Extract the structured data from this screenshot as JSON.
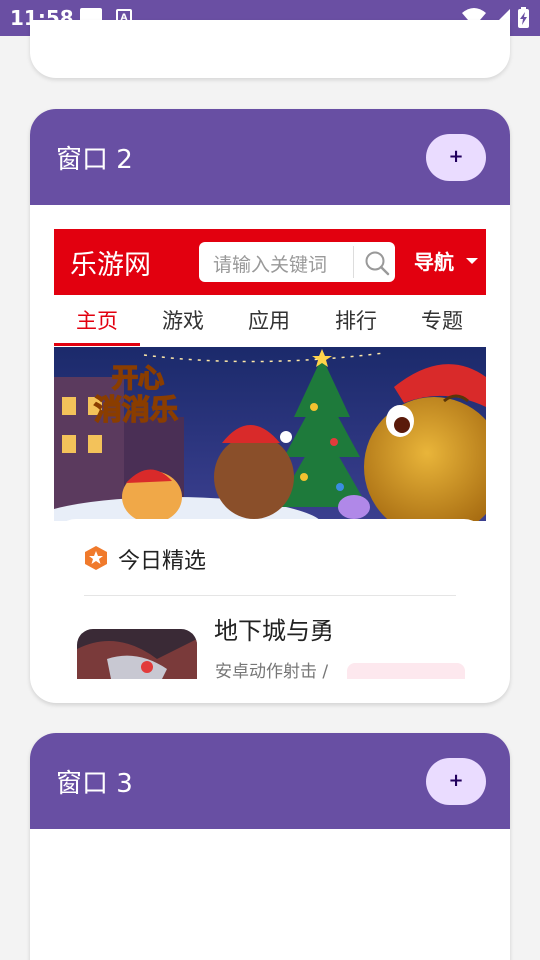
{
  "status_bar": {
    "time": "11:58",
    "icons": [
      "notification-square-icon",
      "accessibility-a-icon",
      "wifi-icon",
      "signal-icon",
      "battery-charging-icon"
    ]
  },
  "colors": {
    "window_header": "#684fa3",
    "add_button_bg": "#eadcff",
    "site_brand_red": "#e2000f"
  },
  "windows": [
    {
      "title": "窗口 2",
      "add_label": "+",
      "web": {
        "logo": "乐游网",
        "search_placeholder": "请输入关键词",
        "nav_label": "导航",
        "tabs": [
          "主页",
          "游戏",
          "应用",
          "排行",
          "专题"
        ],
        "active_tab": "主页",
        "banner_title": "开心消消乐",
        "section_title": "今日精选",
        "game": {
          "name": "地下城与勇",
          "meta": "安卓动作射击 /"
        }
      }
    },
    {
      "title": "窗口 3",
      "add_label": "+"
    }
  ]
}
